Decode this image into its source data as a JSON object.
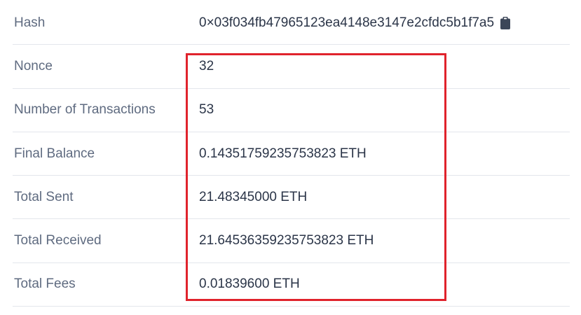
{
  "rows": [
    {
      "label": "Hash",
      "value": "0×03f034fb47965123ea4148e3147e2cfdc5b1f7a5",
      "icon": "clipboard-icon"
    },
    {
      "label": "Nonce",
      "value": "32"
    },
    {
      "label": "Number of Transactions",
      "value": "53"
    },
    {
      "label": "Final Balance",
      "value": "0.14351759235753823 ETH"
    },
    {
      "label": "Total Sent",
      "value": "21.48345000 ETH"
    },
    {
      "label": "Total Received",
      "value": "21.64536359235753823 ETH"
    },
    {
      "label": "Total Fees",
      "value": "0.01839600 ETH"
    }
  ],
  "colors": {
    "label": "#5f6b80",
    "value": "#2b3548",
    "divider": "#e3e6ec",
    "highlight": "#e0232c"
  }
}
